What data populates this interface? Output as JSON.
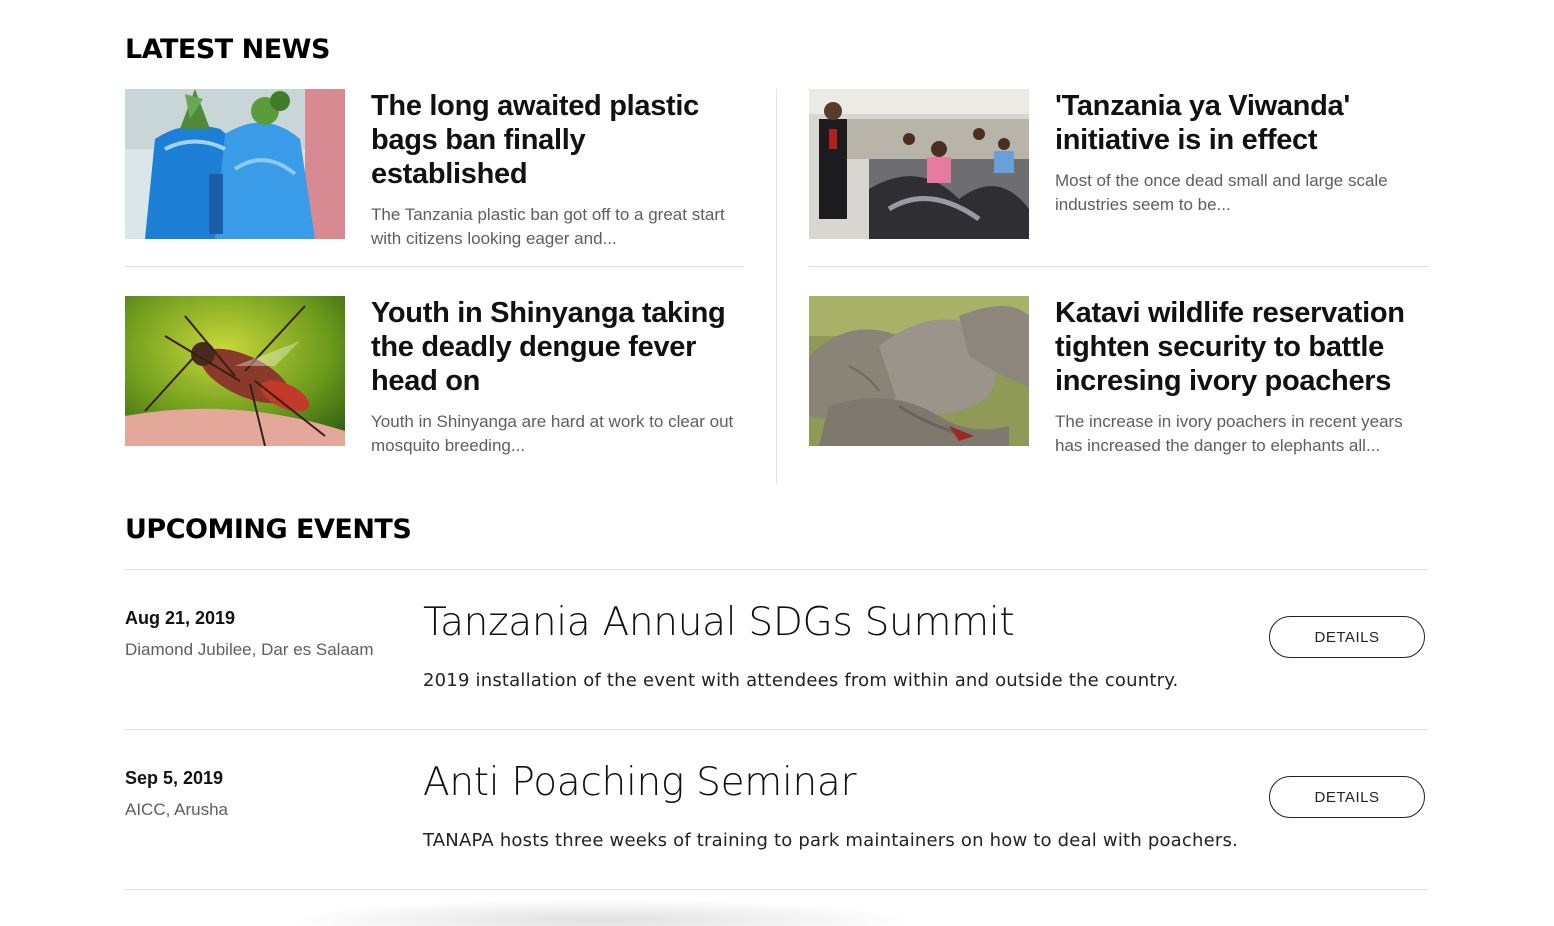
{
  "latest_news": {
    "heading": "LATEST NEWS",
    "items": [
      {
        "title": "The long awaited plastic bags ban finally established",
        "excerpt": "The Tanzania plastic ban got off to a great start with citizens looking eager and...",
        "image_icon": "plastic-bags-photo"
      },
      {
        "title": "'Tanzania ya Viwanda' initiative is in effect",
        "excerpt": "Most of the once dead small and large scale industries seem to be...",
        "image_icon": "factory-photo"
      },
      {
        "title": "Youth in Shinyanga taking the deadly dengue fever head on",
        "excerpt": "Youth in Shinyanga are hard at work to clear out mosquito breeding...",
        "image_icon": "mosquito-photo"
      },
      {
        "title": "Katavi wildlife reservation tighten security to battle incresing ivory poachers",
        "excerpt": "The increase in ivory poachers in recent years has increased the danger to elephants all...",
        "image_icon": "elephants-photo"
      }
    ]
  },
  "upcoming_events": {
    "heading": "UPCOMING EVENTS",
    "items": [
      {
        "date": "Aug 21, 2019",
        "venue": "Diamond Jubilee, Dar es Salaam",
        "title": "Tanzania Annual SDGs Summit",
        "description": "2019 installation of the event with attendees from within and outside the country.",
        "button_label": "DETAILS"
      },
      {
        "date": "Sep 5, 2019",
        "venue": "AICC, Arusha",
        "title": "Anti Poaching Seminar",
        "description": "TANAPA hosts three weeks of training to park maintainers on how to deal with poachers.",
        "button_label": "DETAILS"
      }
    ]
  },
  "colors": {
    "heading": "#000000",
    "excerpt": "#5e5e5e",
    "divider": "#e0e0e0"
  }
}
